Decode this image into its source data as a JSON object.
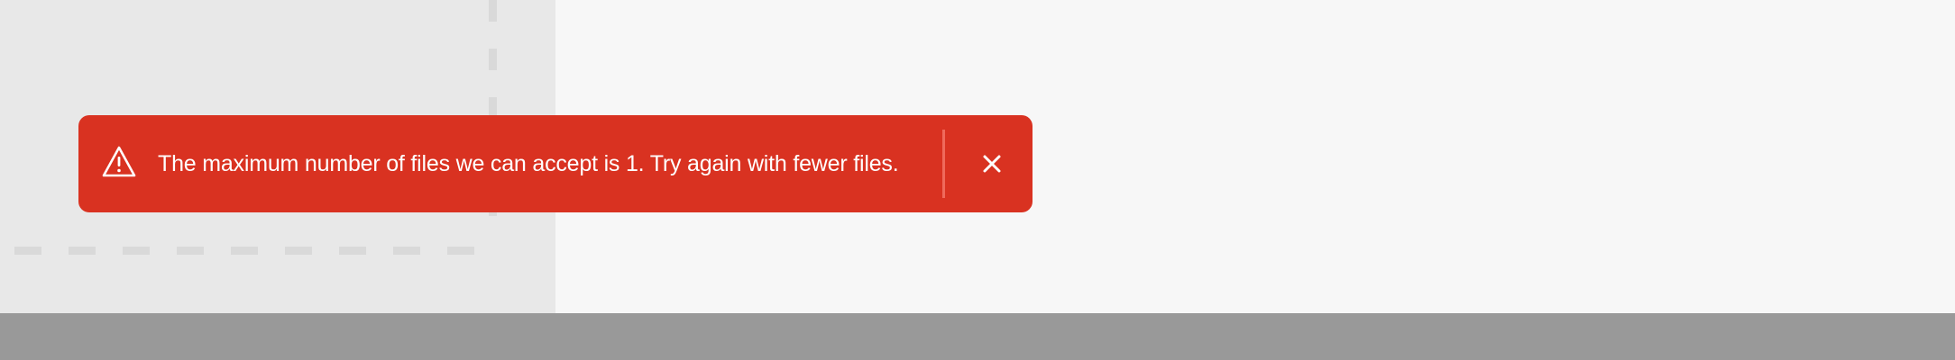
{
  "toast": {
    "type": "error",
    "icon": "warning-triangle-icon",
    "message": "The maximum number of files we can accept is 1. Try again with fewer files.",
    "close_icon": "close-icon",
    "background_color": "#d93221",
    "text_color": "#ffffff"
  },
  "drop_zone": {
    "border_style": "dashed"
  }
}
